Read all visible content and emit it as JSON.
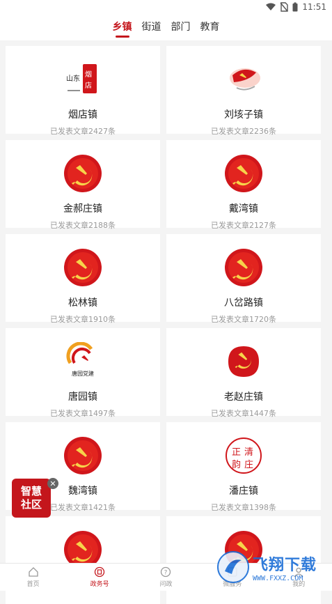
{
  "status_bar": {
    "time": "11:51"
  },
  "tabs": [
    {
      "label": "乡镇",
      "active": true
    },
    {
      "label": "街道",
      "active": false
    },
    {
      "label": "部门",
      "active": false
    },
    {
      "label": "教育",
      "active": false
    }
  ],
  "cards": [
    {
      "name": "烟店镇",
      "count": "已发表文章2427条",
      "logo_icon": "yandian-calligraphy-logo"
    },
    {
      "name": "刘垓子镇",
      "count": "已发表文章2236条",
      "logo_icon": "party-flag-brush-logo"
    },
    {
      "name": "金郝庄镇",
      "count": "已发表文章2188条",
      "logo_icon": "party-emblem-logo"
    },
    {
      "name": "戴湾镇",
      "count": "已发表文章2127条",
      "logo_icon": "party-emblem-logo"
    },
    {
      "name": "松林镇",
      "count": "已发表文章1910条",
      "logo_icon": "party-emblem-logo"
    },
    {
      "name": "八岔路镇",
      "count": "已发表文章1720条",
      "logo_icon": "party-emblem-logo"
    },
    {
      "name": "唐园镇",
      "count": "已发表文章1497条",
      "logo_icon": "tangyuan-party-logo"
    },
    {
      "name": "老赵庄镇",
      "count": "已发表文章1447条",
      "logo_icon": "party-emblem-seal-logo"
    },
    {
      "name": "魏湾镇",
      "count": "已发表文章1421条",
      "logo_icon": "party-emblem-logo"
    },
    {
      "name": "潘庄镇",
      "count": "已发表文章1398条",
      "logo_icon": "zhengqing-seal-logo"
    },
    {
      "name": "",
      "count": "",
      "logo_icon": "party-emblem-logo"
    },
    {
      "name": "",
      "count": "",
      "logo_icon": "party-emblem-logo"
    }
  ],
  "floating_button": {
    "line1": "智慧",
    "line2": "社区"
  },
  "bottom_nav": [
    {
      "label": "首页",
      "icon": "home-icon",
      "active": false
    },
    {
      "label": "政务号",
      "icon": "government-icon",
      "active": true
    },
    {
      "label": "问政",
      "icon": "question-icon",
      "active": false
    },
    {
      "label": "微服务",
      "icon": "service-icon",
      "active": false
    },
    {
      "label": "我的",
      "icon": "profile-icon",
      "active": false
    }
  ],
  "watermark": {
    "title": "飞翔下载",
    "url": "WWW.FXXZ.COM"
  },
  "colors": {
    "accent": "#c4161c",
    "background": "#f4f4f4"
  }
}
